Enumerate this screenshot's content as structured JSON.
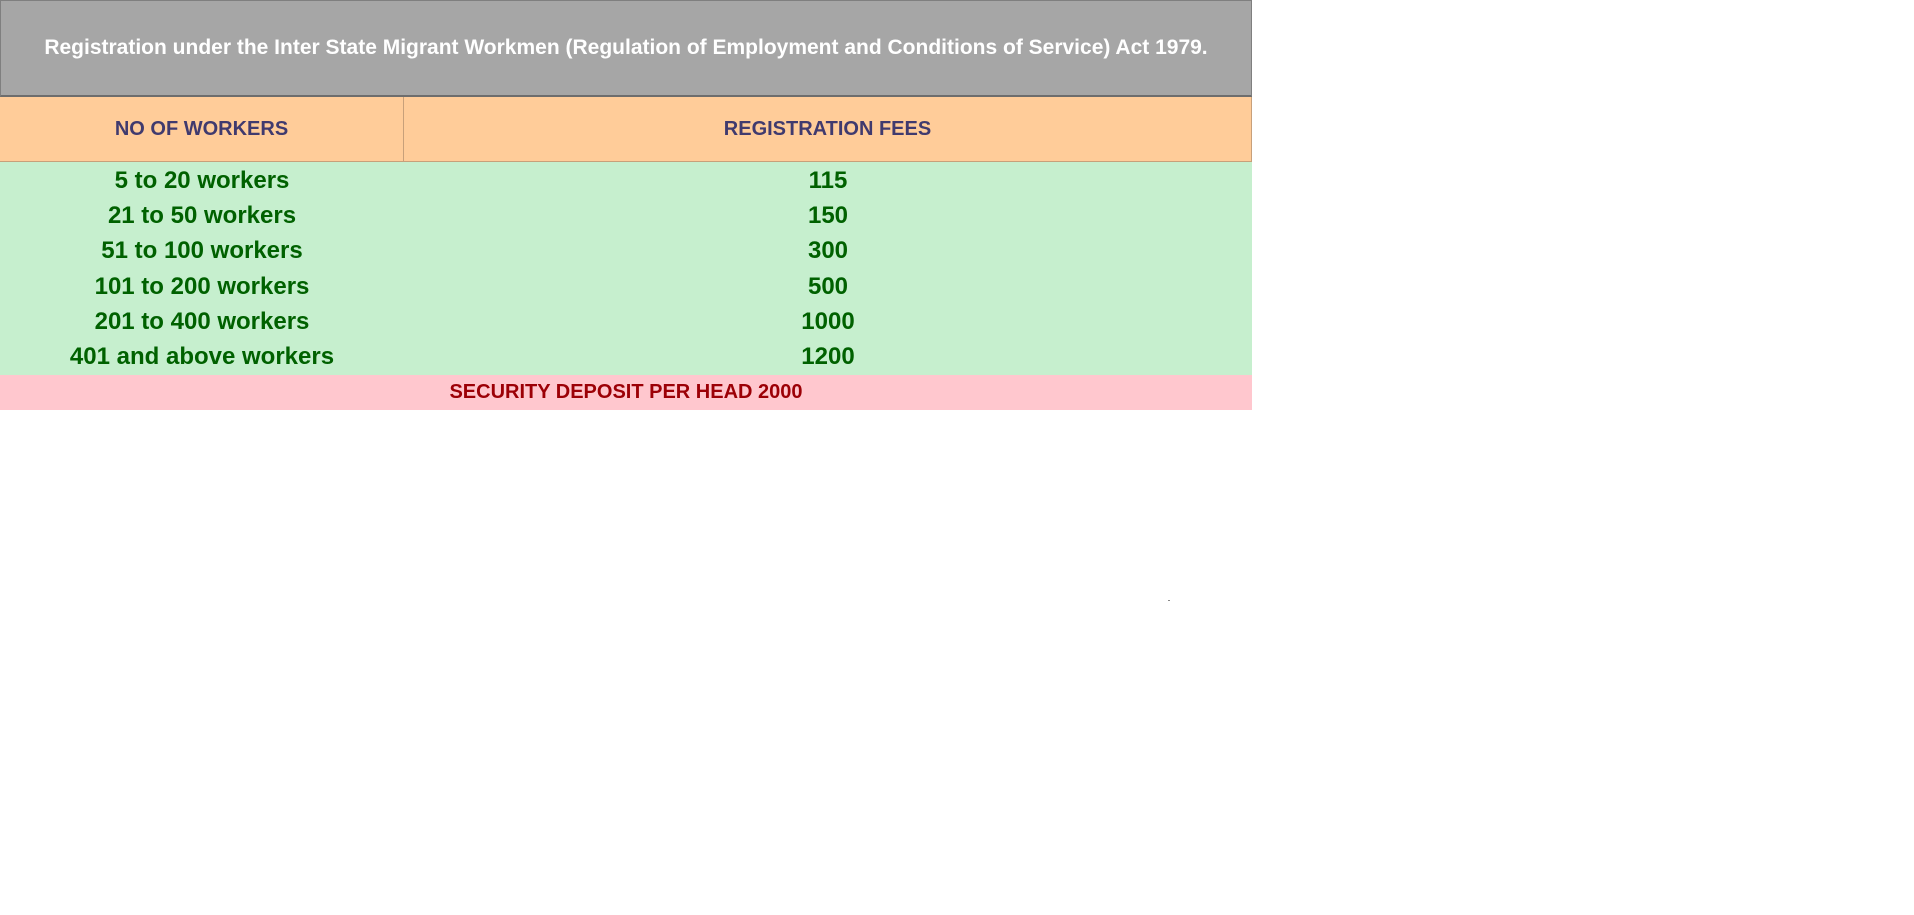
{
  "title": "Registration under the Inter State Migrant Workmen (Regulation of Employment and Conditions of Service) Act 1979.",
  "table": {
    "headers": [
      "NO OF WORKERS",
      "REGISTRATION FEES"
    ],
    "rows": [
      {
        "workers": "5 to 20 workers",
        "fee": "115"
      },
      {
        "workers": "21 to 50 workers",
        "fee": "150"
      },
      {
        "workers": "51 to 100 workers",
        "fee": "300"
      },
      {
        "workers": "101 to 200 workers",
        "fee": "500"
      },
      {
        "workers": "201 to 400 workers",
        "fee": "1000"
      },
      {
        "workers": "401 and above workers",
        "fee": "1200"
      }
    ]
  },
  "deposit": "SECURITY DEPOSIT PER HEAD 2000",
  "colors": {
    "title_bg": "#a6a6a6",
    "header_bg": "#ffcc99",
    "header_text": "#403a6e",
    "data_bg": "#c6efce",
    "data_text": "#006100",
    "deposit_bg": "#ffc7ce",
    "deposit_text": "#9c0006"
  }
}
